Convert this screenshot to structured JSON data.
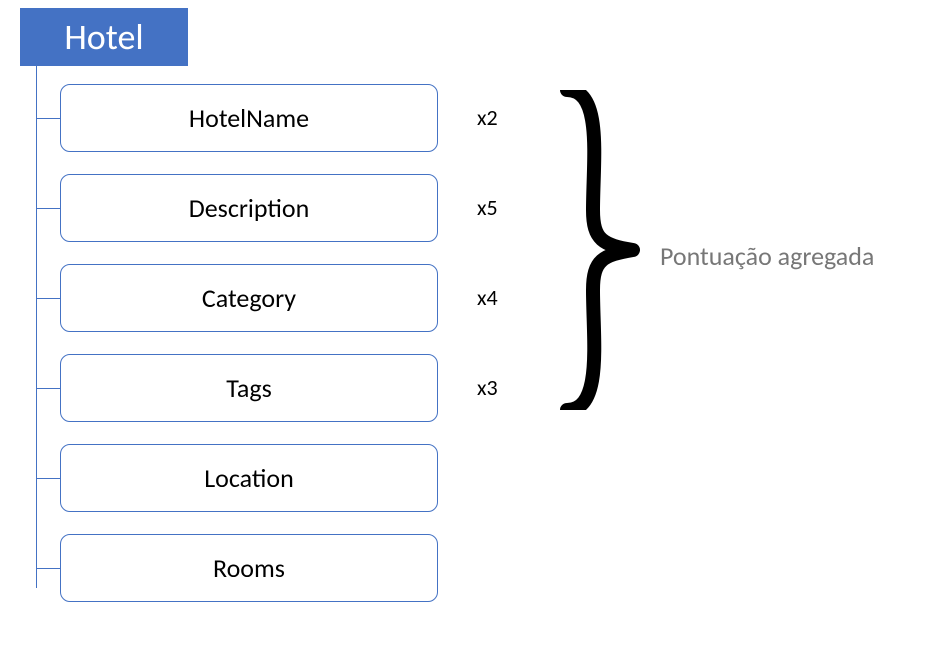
{
  "root": {
    "label": "Hotel"
  },
  "fields": [
    {
      "name": "HotelName",
      "multiplier": "x2"
    },
    {
      "name": "Description",
      "multiplier": "x5"
    },
    {
      "name": "Category",
      "multiplier": "x4"
    },
    {
      "name": "Tags",
      "multiplier": "x3"
    },
    {
      "name": "Location",
      "multiplier": ""
    },
    {
      "name": "Rooms",
      "multiplier": ""
    }
  ],
  "annotation": {
    "label": "Pontuação agregada"
  }
}
